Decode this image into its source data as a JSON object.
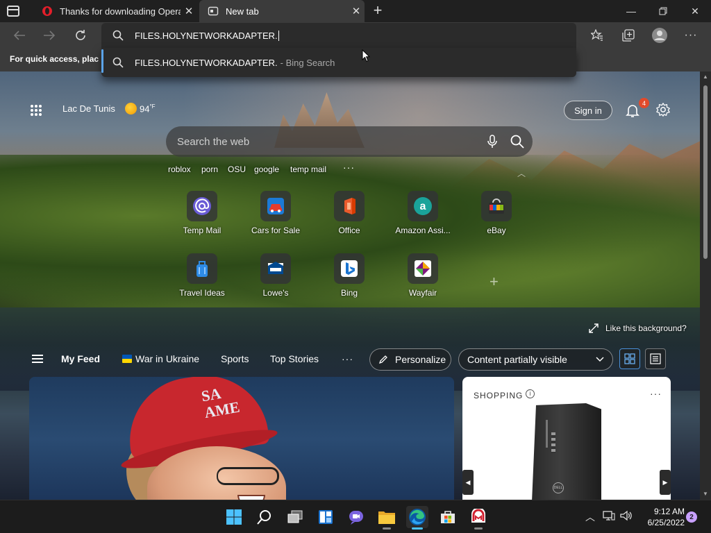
{
  "tabs": [
    {
      "title": "Thanks for downloading Opera"
    },
    {
      "title": "New tab"
    }
  ],
  "address_bar": {
    "value": "FILES.HOLYNETWORKADAPTER."
  },
  "suggestion": {
    "query": "FILES.HOLYNETWORKADAPTER.",
    "source": " - Bing Search"
  },
  "favorites_hint": "For quick access, place y",
  "weather": {
    "location": "Lac De Tunis",
    "temp": "94",
    "unit": "°F"
  },
  "header": {
    "sign_in": "Sign in",
    "notification_count": "4"
  },
  "search": {
    "placeholder": "Search the web"
  },
  "trending": [
    "roblox",
    "porn",
    "OSU",
    "google",
    "temp mail"
  ],
  "trending_more": "···",
  "quick_links": [
    {
      "label": "Temp Mail",
      "icon": "at-icon"
    },
    {
      "label": "Cars for Sale",
      "icon": "cars-icon"
    },
    {
      "label": "Office",
      "icon": "office-icon"
    },
    {
      "label": "Amazon Assi...",
      "icon": "amazon-icon"
    },
    {
      "label": "eBay",
      "icon": "ebay-icon"
    },
    {
      "label": "Travel Ideas",
      "icon": "travel-bag-icon"
    },
    {
      "label": "Lowe's",
      "icon": "lowes-icon"
    },
    {
      "label": "Bing",
      "icon": "bing-icon"
    },
    {
      "label": "Wayfair",
      "icon": "wayfair-icon"
    }
  ],
  "like_background": "Like this background?",
  "feed_nav": {
    "my_feed": "My Feed",
    "items": [
      "War in Ukraine",
      "Sports",
      "Top Stories"
    ],
    "more": "···",
    "personalize": "Personalize",
    "visibility": "Content partially visible"
  },
  "news_card": {
    "cap_text": "SA\nAME"
  },
  "shopping": {
    "header": "SHOPPING",
    "more": "···"
  },
  "taskbar": {
    "time": "9:12 AM",
    "date": "6/25/2022",
    "notifications": "2"
  },
  "colors": {
    "accent": "#4cc2ff",
    "badge": "#e24a2b",
    "suggest_bar": "#5ba3e8"
  }
}
